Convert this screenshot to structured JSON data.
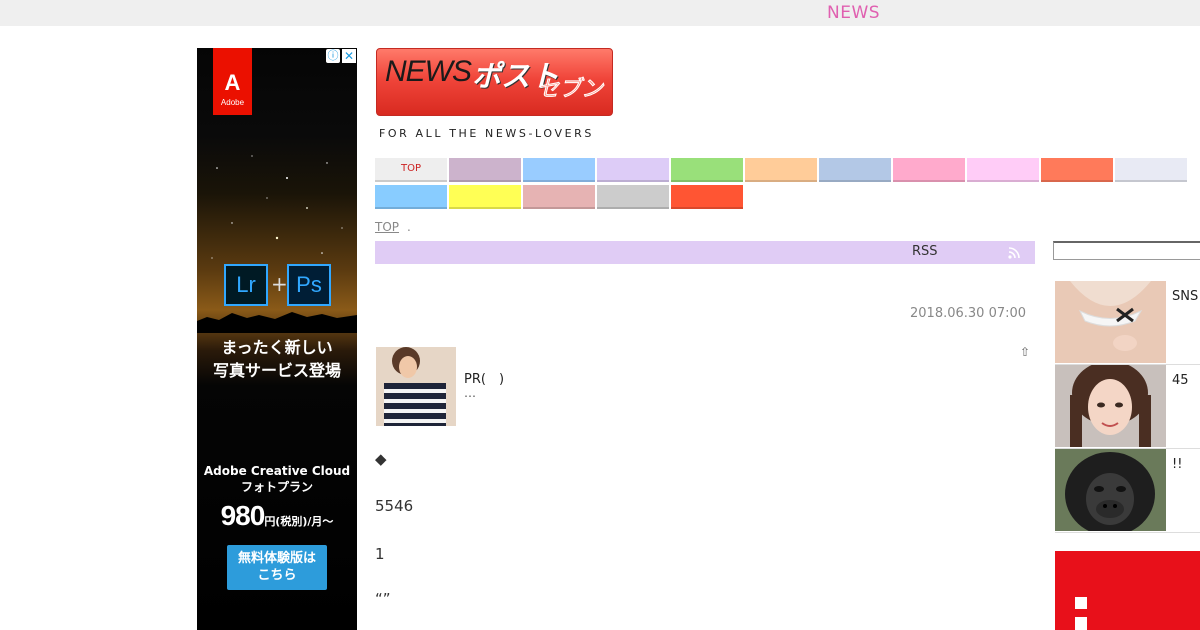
{
  "header": {
    "title": "NEWS"
  },
  "ad": {
    "brand": "Adobe",
    "app_left": "Lr",
    "app_right": "Ps",
    "plus": "+",
    "headline_line1": "まったく新しい",
    "headline_line2": "写真サービス登場",
    "product_line1": "Adobe Creative Cloud",
    "product_line2": "フォトプラン",
    "price_number": "980",
    "price_suffix": "円(税別)/月〜",
    "cta_line1": "無料体験版は",
    "cta_line2": "こちら",
    "info_glyph": "ⓘ",
    "close_glyph": "✕"
  },
  "logo": {
    "news": "NEWS",
    "post": "ポスト",
    "seven": "セブン",
    "tagline": "FOR ALL THE NEWS-LOVERS"
  },
  "nav": {
    "items": [
      {
        "label": "TOP",
        "color": "#eeeeee"
      },
      {
        "label": "",
        "color": "#ccb3cc"
      },
      {
        "label": "",
        "color": "#99ccff"
      },
      {
        "label": "",
        "color": "#ddccf7"
      },
      {
        "label": "",
        "color": "#99e07a"
      },
      {
        "label": "",
        "color": "#ffcc99"
      },
      {
        "label": "",
        "color": "#b3c8e6"
      },
      {
        "label": "",
        "color": "#ffaacc"
      },
      {
        "label": "",
        "color": "#ffccf7"
      },
      {
        "label": "",
        "color": "#ff7a5a"
      },
      {
        "label": "",
        "color": "#e8eaf4"
      },
      {
        "label": "",
        "color": "#88ccff"
      },
      {
        "label": "",
        "color": "#ffff55"
      },
      {
        "label": "",
        "color": "#e6b3b3"
      },
      {
        "label": "",
        "color": "#cccccc"
      },
      {
        "label": "",
        "color": "#ff5533"
      }
    ]
  },
  "breadcrumb": {
    "home": "TOP",
    "sep": "."
  },
  "rss": {
    "label": "RSS"
  },
  "article": {
    "date": "2018.06.30 07:00",
    "share_glyph": "⇧",
    "pr_title": "PR(　)",
    "pr_ellipsis": "…",
    "diamond": "◆",
    "number": "5546",
    "one": "1",
    "quotes": "“”"
  },
  "sidebar": {
    "items": [
      {
        "text": "SNS"
      },
      {
        "text": "45"
      },
      {
        "text": "!!"
      }
    ]
  }
}
